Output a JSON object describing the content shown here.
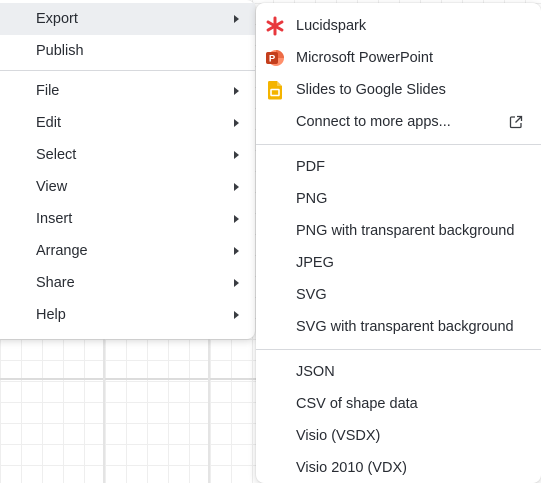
{
  "main_menu": {
    "items": [
      {
        "label": "Export",
        "submenu": true,
        "active": true
      },
      {
        "label": "Publish",
        "submenu": false
      },
      {
        "label": "File",
        "submenu": true
      },
      {
        "label": "Edit",
        "submenu": true
      },
      {
        "label": "Select",
        "submenu": true
      },
      {
        "label": "View",
        "submenu": true
      },
      {
        "label": "Insert",
        "submenu": true
      },
      {
        "label": "Arrange",
        "submenu": true
      },
      {
        "label": "Share",
        "submenu": true
      },
      {
        "label": "Help",
        "submenu": true
      }
    ]
  },
  "export_menu": {
    "apps": [
      {
        "label": "Lucidspark",
        "icon": "lucidspark-icon"
      },
      {
        "label": "Microsoft PowerPoint",
        "icon": "powerpoint-icon"
      },
      {
        "label": "Slides to Google Slides",
        "icon": "google-slides-icon"
      },
      {
        "label": "Connect to more apps...",
        "icon": "external-link-icon"
      }
    ],
    "images": [
      {
        "label": "PDF"
      },
      {
        "label": "PNG"
      },
      {
        "label": "PNG with transparent background"
      },
      {
        "label": "JPEG"
      },
      {
        "label": "SVG"
      },
      {
        "label": "SVG with transparent background"
      }
    ],
    "data": [
      {
        "label": "JSON"
      },
      {
        "label": "CSV of shape data"
      },
      {
        "label": "Visio (VSDX)"
      },
      {
        "label": "Visio 2010 (VDX)"
      }
    ]
  },
  "colors": {
    "lucidspark_red": "#e8383d",
    "powerpoint_orange": "#d24726",
    "google_slides_yellow": "#f4b400",
    "active_item_bg": "#eceef1"
  }
}
